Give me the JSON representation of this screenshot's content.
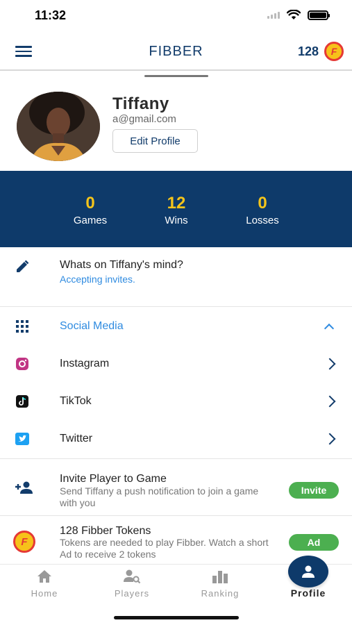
{
  "status": {
    "time": "11:32"
  },
  "header": {
    "title": "FIBBER",
    "token_count": "128",
    "coin_letter": "F"
  },
  "profile": {
    "name": "Tiffany",
    "email": "a@gmail.com",
    "edit_label": "Edit Profile"
  },
  "stats": [
    {
      "value": "0",
      "label": "Games"
    },
    {
      "value": "12",
      "label": "Wins"
    },
    {
      "value": "0",
      "label": "Losses"
    }
  ],
  "mind": {
    "title": "Whats on Tiffany's mind?",
    "status": "Accepting invites."
  },
  "social": {
    "title": "Social Media",
    "items": [
      {
        "label": "Instagram",
        "icon": "instagram-icon"
      },
      {
        "label": "TikTok",
        "icon": "tiktok-icon"
      },
      {
        "label": "Twitter",
        "icon": "twitter-icon"
      }
    ]
  },
  "invite": {
    "title": "Invite Player to Game",
    "desc": "Send Tiffany a push notification to join a game with you",
    "button": "Invite"
  },
  "tokens": {
    "title": "128 Fibber Tokens",
    "desc": "Tokens are needed to play Fibber. Watch a short Ad to receive 2 tokens",
    "button": "Ad"
  },
  "tabs": [
    {
      "label": "Home",
      "icon": "home-icon"
    },
    {
      "label": "Players",
      "icon": "players-search-icon"
    },
    {
      "label": "Ranking",
      "icon": "ranking-icon"
    },
    {
      "label": "Profile",
      "icon": "profile-icon",
      "active": true
    }
  ],
  "colors": {
    "primary": "#0e3a6a",
    "accent": "#f4c41b",
    "link": "#2f8be0",
    "success": "#4caf50"
  }
}
